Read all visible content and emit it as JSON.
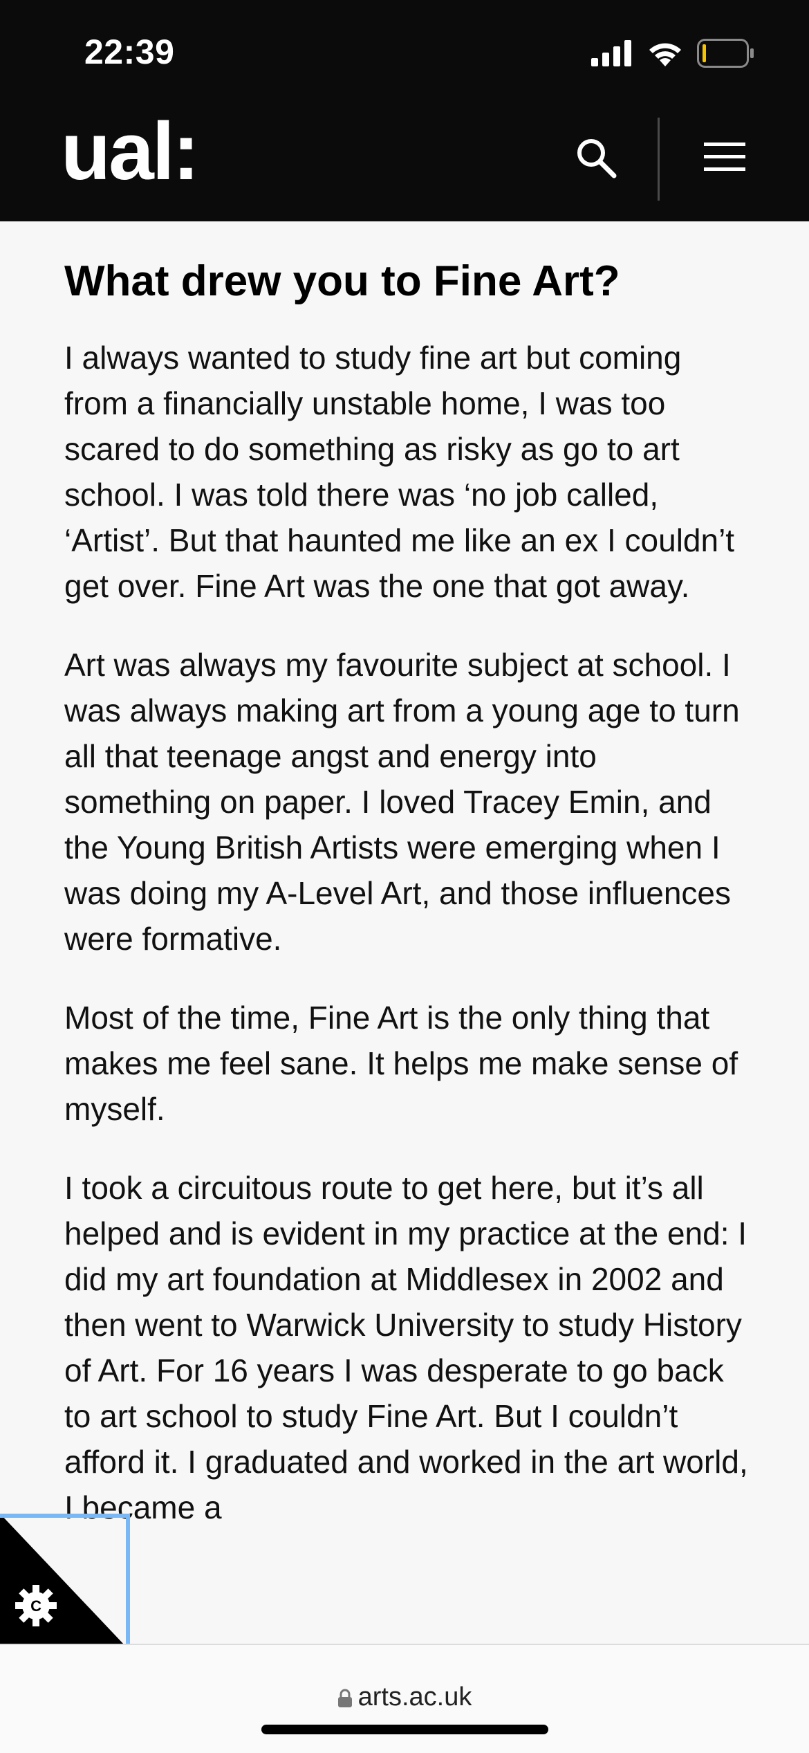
{
  "status_bar": {
    "time": "22:39",
    "icons": [
      "signal-bars-icon",
      "wifi-icon",
      "battery-low-icon"
    ]
  },
  "header": {
    "logo_text": "ual:",
    "search_icon": "search-icon",
    "menu_icon": "hamburger-menu-icon"
  },
  "article": {
    "heading": "What drew you to Fine Art?",
    "paragraphs": [
      "I always wanted to study fine art but coming from a financially unstable home, I was too scared to do something as risky as go to art school. I was told there was ‘no job called, ‘Artist’. But that haunted me like an ex I couldn’t get over. Fine Art was the one that got away.",
      "Art was always my favourite subject at school. I was always making art from a young age to turn all that teenage angst and energy into something on paper. I loved Tracey Emin, and the Young British Artists were emerging when I was doing my A-Level Art, and those influences were formative.",
      "Most of the time, Fine Art is the only thing that makes me feel sane. It helps me make sense of myself.",
      "I took a circuitous route to get here, but it’s all helped and is evident in my practice at the end: I did my art foundation at Middlesex in 2002 and then went to Warwick University to study History of Art. For 16 years I was desperate to go back to art school to study Fine Art. But I couldn’t afford it. I graduated and worked in the art world, I became a"
    ]
  },
  "cookie_widget": {
    "icon": "cookie-settings-gear-icon"
  },
  "browser_bar": {
    "url": "arts.ac.uk",
    "lock_icon": "lock-icon"
  },
  "colors": {
    "header_bg": "#0b0b0b",
    "page_bg": "#f7f7f7",
    "focus_outline": "#7ab8f5"
  }
}
